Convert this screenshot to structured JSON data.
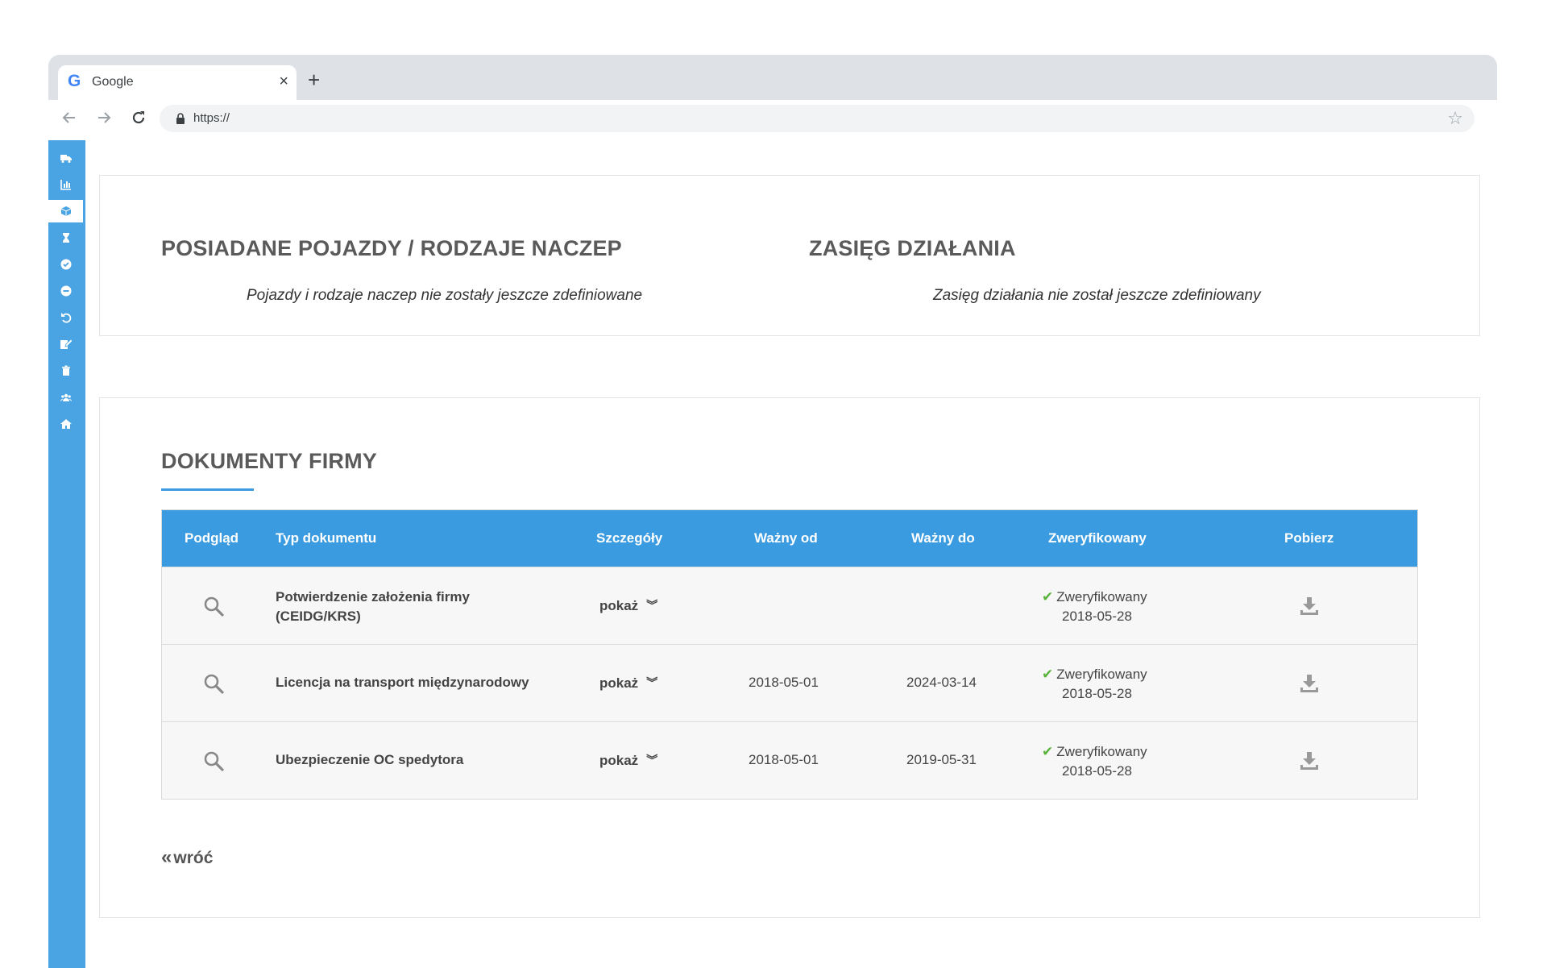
{
  "browser": {
    "tab_title": "Google",
    "tab_favicon": "G",
    "tab_close": "×",
    "new_tab": "+",
    "url": "https://"
  },
  "sidebar": {
    "items": [
      {
        "icon": "truck-icon"
      },
      {
        "icon": "chart-icon"
      },
      {
        "icon": "cube-icon",
        "active": true
      },
      {
        "icon": "hourglass-icon"
      },
      {
        "icon": "check-circle-icon"
      },
      {
        "icon": "minus-circle-icon"
      },
      {
        "icon": "undo-icon"
      },
      {
        "icon": "edit-icon"
      },
      {
        "icon": "trash-icon"
      },
      {
        "icon": "users-icon"
      },
      {
        "icon": "home-icon"
      }
    ]
  },
  "vehicles": {
    "title": "POSIADANE POJAZDY / RODZAJE NACZEP",
    "empty": "Pojazdy i rodzaje naczep nie zostały jeszcze zdefiniowane"
  },
  "range": {
    "title": "ZASIĘG DZIAŁANIA",
    "empty": "Zasięg działania nie został jeszcze zdefiniowany"
  },
  "documents": {
    "title": "DOKUMENTY FIRMY",
    "columns": {
      "preview": "Podgląd",
      "type": "Typ dokumentu",
      "details": "Szczegóły",
      "valid_from": "Ważny od",
      "valid_to": "Ważny do",
      "verified": "Zweryfikowany",
      "download": "Pobierz"
    },
    "rows": [
      {
        "type_line1": "Potwierdzenie założenia firmy",
        "type_line2": "(CEIDG/KRS)",
        "details": "pokaż",
        "valid_from": "",
        "valid_to": "",
        "verified_label": "Zweryfikowany",
        "verified_date": "2018-05-28"
      },
      {
        "type_line1": "Licencja na transport międzynarodowy",
        "type_line2": "",
        "details": "pokaż",
        "valid_from": "2018-05-01",
        "valid_to": "2024-03-14",
        "verified_label": "Zweryfikowany",
        "verified_date": "2018-05-28"
      },
      {
        "type_line1": "Ubezpieczenie OC spedytora",
        "type_line2": "",
        "details": "pokaż",
        "valid_from": "2018-05-01",
        "valid_to": "2019-05-31",
        "verified_label": "Zweryfikowany",
        "verified_date": "2018-05-28"
      }
    ],
    "back": "wróć"
  },
  "colors": {
    "accent": "#3b9be0",
    "sidebar": "#4aa3e2",
    "verified": "#59b33a"
  }
}
